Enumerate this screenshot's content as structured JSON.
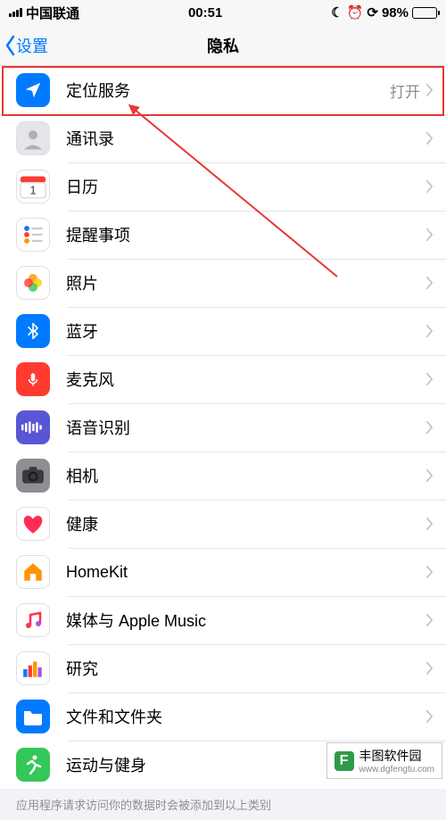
{
  "status": {
    "carrier": "中国联通",
    "time": "00:51",
    "battery_pct": "98%"
  },
  "nav": {
    "back": "设置",
    "title": "隐私"
  },
  "rows": [
    {
      "label": "定位服务",
      "status": "打开",
      "icon": "location",
      "bg": "#007aff"
    },
    {
      "label": "通讯录",
      "status": "",
      "icon": "contacts",
      "bg": "#e5e5ea"
    },
    {
      "label": "日历",
      "status": "",
      "icon": "calendar",
      "bg": "#ffffff"
    },
    {
      "label": "提醒事项",
      "status": "",
      "icon": "reminders",
      "bg": "#ffffff"
    },
    {
      "label": "照片",
      "status": "",
      "icon": "photos",
      "bg": "#ffffff"
    },
    {
      "label": "蓝牙",
      "status": "",
      "icon": "bluetooth",
      "bg": "#007aff"
    },
    {
      "label": "麦克风",
      "status": "",
      "icon": "mic",
      "bg": "#ff3b30"
    },
    {
      "label": "语音识别",
      "status": "",
      "icon": "speech",
      "bg": "#5856d6"
    },
    {
      "label": "相机",
      "status": "",
      "icon": "camera",
      "bg": "#8e8e93"
    },
    {
      "label": "健康",
      "status": "",
      "icon": "health",
      "bg": "#ffffff"
    },
    {
      "label": "HomeKit",
      "status": "",
      "icon": "homekit",
      "bg": "#ffffff"
    },
    {
      "label": "媒体与 Apple Music",
      "status": "",
      "icon": "music",
      "bg": "#ffffff"
    },
    {
      "label": "研究",
      "status": "",
      "icon": "research",
      "bg": "#ffffff"
    },
    {
      "label": "文件和文件夹",
      "status": "",
      "icon": "files",
      "bg": "#007aff"
    },
    {
      "label": "运动与健身",
      "status": "",
      "icon": "fitness",
      "bg": "#34c759"
    }
  ],
  "footer": "应用程序请求访问你的数据时会被添加到以上类别",
  "watermark": {
    "title": "丰图软件园",
    "url": "www.dgfengtu.com",
    "logo_letter": "F"
  }
}
